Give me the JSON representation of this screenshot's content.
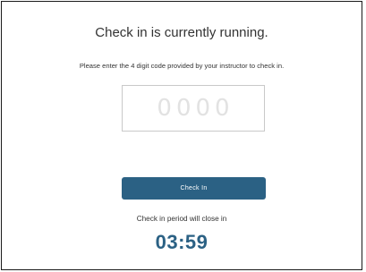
{
  "header": {
    "title": "Check in is currently running."
  },
  "form": {
    "instruction": "Please enter the 4 digit code provided by your instructor to check in.",
    "code_placeholder": "0000",
    "code_value": "",
    "submit_label": "Check In"
  },
  "countdown": {
    "label": "Check in period will close in",
    "remaining": "03:59"
  },
  "colors": {
    "accent": "#2b6184",
    "text": "#333333",
    "input_border": "#c9c9c9",
    "placeholder": "#e2e2e2"
  }
}
